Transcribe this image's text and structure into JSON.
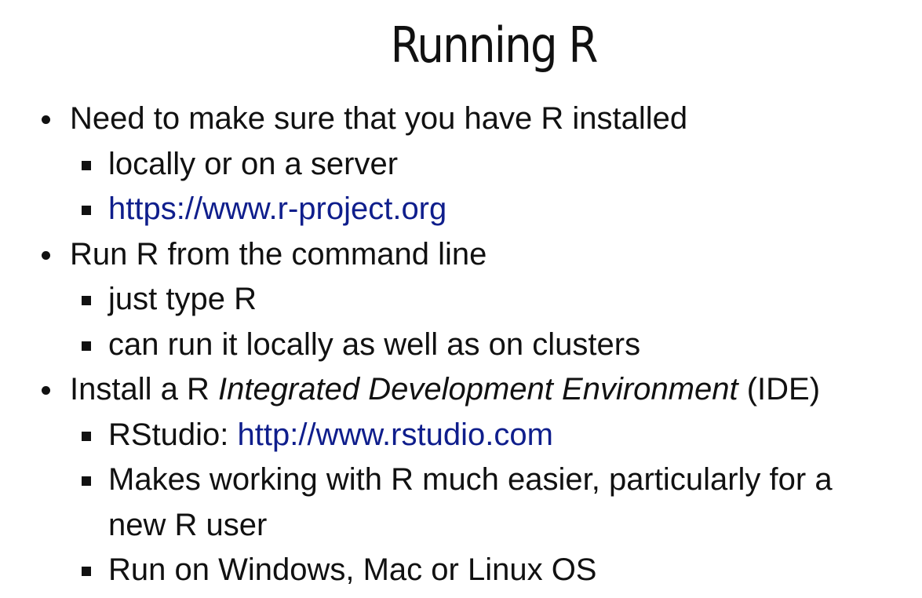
{
  "slide": {
    "title": "Running",
    "title_r": "R"
  },
  "bullets": [
    {
      "text": "Need to make sure that you have R installed",
      "subitems": [
        {
          "text": "locally or on a server"
        },
        {
          "link": "https://www.r-project.org"
        }
      ]
    },
    {
      "text": "Run R from the command line",
      "subitems": [
        {
          "text": "just type R"
        },
        {
          "text": "can run it locally as well as on clusters"
        }
      ]
    },
    {
      "prefix": "Install a R ",
      "emphasis": "Integrated Development Environment",
      "suffix": " (IDE)",
      "subitems": [
        {
          "prefix": "RStudio: ",
          "link": "http://www.rstudio.com"
        },
        {
          "text_line1": "Makes working with R much easier, particularly for a",
          "text_line2": "new R user"
        },
        {
          "text": "Run on Windows, Mac or Linux OS"
        }
      ]
    }
  ],
  "colors": {
    "text": "#111111",
    "link": "#0f1e8c",
    "background": "#ffffff"
  }
}
